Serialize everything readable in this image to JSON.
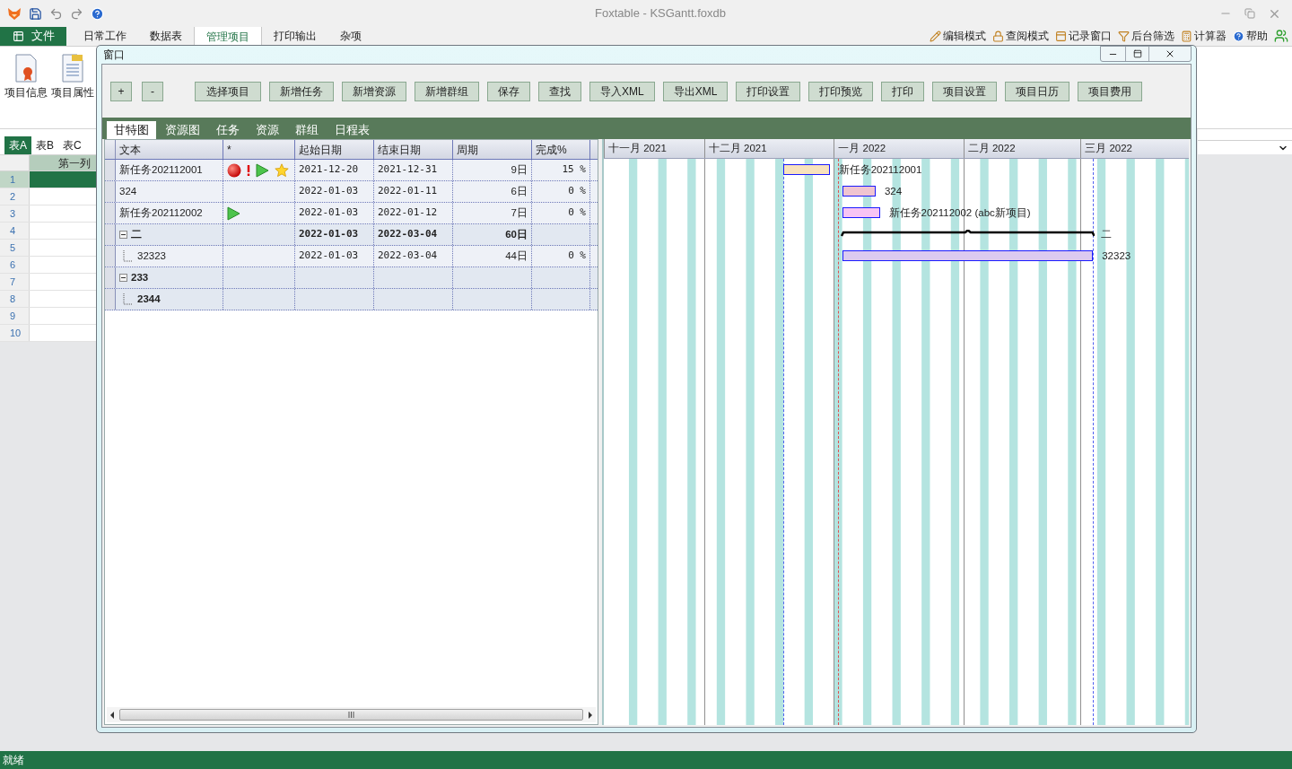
{
  "app": {
    "title": "Foxtable - KSGantt.foxdb"
  },
  "ribbon": {
    "file_button": "文件",
    "tabs": [
      {
        "label": "日常工作",
        "selected": false
      },
      {
        "label": "数据表",
        "selected": false
      },
      {
        "label": "管理项目",
        "selected": true
      },
      {
        "label": "打印输出",
        "selected": false
      },
      {
        "label": "杂项",
        "selected": false
      }
    ],
    "tools": [
      "编辑模式",
      "查阅模式",
      "记录窗口",
      "后台筛选",
      "计算器",
      "帮助"
    ],
    "commands": [
      "项目信息",
      "项目属性"
    ]
  },
  "sheet_tabs": [
    {
      "label": "表A",
      "selected": true
    },
    {
      "label": "表B",
      "selected": false
    },
    {
      "label": "表C",
      "selected": false
    }
  ],
  "sheet": {
    "column": "第一列",
    "rows": [
      {
        "number": "1",
        "selected": true
      },
      {
        "number": "2",
        "selected": false
      },
      {
        "number": "3",
        "selected": false
      },
      {
        "number": "4",
        "selected": false
      },
      {
        "number": "5",
        "selected": false
      },
      {
        "number": "6",
        "selected": false
      },
      {
        "number": "7",
        "selected": false
      },
      {
        "number": "8",
        "selected": false
      },
      {
        "number": "9",
        "selected": false
      },
      {
        "number": "10",
        "selected": false
      }
    ]
  },
  "dialog": {
    "title": "窗口",
    "toolbar": [
      "+",
      "-",
      "选择项目",
      "新增任务",
      "新增资源",
      "新增群组",
      "保存",
      "查找",
      "导入XML",
      "导出XML",
      "打印设置",
      "打印预览",
      "打印",
      "项目设置",
      "项目日历",
      "项目费用"
    ],
    "tabs": [
      {
        "label": "甘特图",
        "selected": true
      },
      {
        "label": "资源图",
        "selected": false
      },
      {
        "label": "任务",
        "selected": false
      },
      {
        "label": "资源",
        "selected": false
      },
      {
        "label": "群组",
        "selected": false
      },
      {
        "label": "日程表",
        "selected": false
      }
    ],
    "grid": {
      "columns": [
        "文本",
        "*",
        "起始日期",
        "结束日期",
        "周期",
        "完成%"
      ],
      "rows": [
        {
          "kind": "task",
          "text": "新任务202112001",
          "indicators": [
            {
              "kind": "stop"
            },
            {
              "kind": "alert"
            },
            {
              "kind": "play"
            },
            {
              "kind": "star"
            }
          ],
          "start": "2021-12-20",
          "end": "2021-12-31",
          "duration": "9日",
          "complete": "15 %",
          "bar": {
            "label": "新任务202112001",
            "color": "#f8e2bc"
          }
        },
        {
          "kind": "task",
          "text": "324",
          "start": "2022-01-03",
          "end": "2022-01-11",
          "duration": "6日",
          "complete": "0 %",
          "bar": {
            "label": "324",
            "color": "#f0c4d0"
          }
        },
        {
          "kind": "task",
          "text": "新任务202112002",
          "indicators": [
            {
              "kind": "play"
            }
          ],
          "start": "2022-01-03",
          "end": "2022-01-12",
          "duration": "7日",
          "complete": "0 %",
          "bar": {
            "label": "新任务202112002 (abc新项目)",
            "color": "#f8c4f4"
          }
        },
        {
          "kind": "group",
          "text": "二",
          "expanded": true,
          "start": "2022-01-03",
          "end": "2022-03-04",
          "duration": "60日",
          "bar": {
            "label": "二"
          },
          "children": [
            {
              "kind": "task",
              "text": "32323",
              "start": "2022-01-03",
              "end": "2022-03-04",
              "duration": "44日",
              "complete": "0 %",
              "bar": {
                "label": "32323",
                "color": "#dccaf0"
              }
            }
          ]
        },
        {
          "kind": "group",
          "text": "233",
          "expanded": true,
          "children": [
            {
              "kind": "group",
              "text": "2344"
            }
          ]
        }
      ]
    },
    "gantt": {
      "months": [
        {
          "label": "十一月 2021"
        },
        {
          "label": "十二月 2021"
        },
        {
          "label": "一月 2022"
        },
        {
          "label": "二月 2022"
        },
        {
          "label": "三月 2022"
        }
      ]
    }
  },
  "status_bar": "就绪"
}
